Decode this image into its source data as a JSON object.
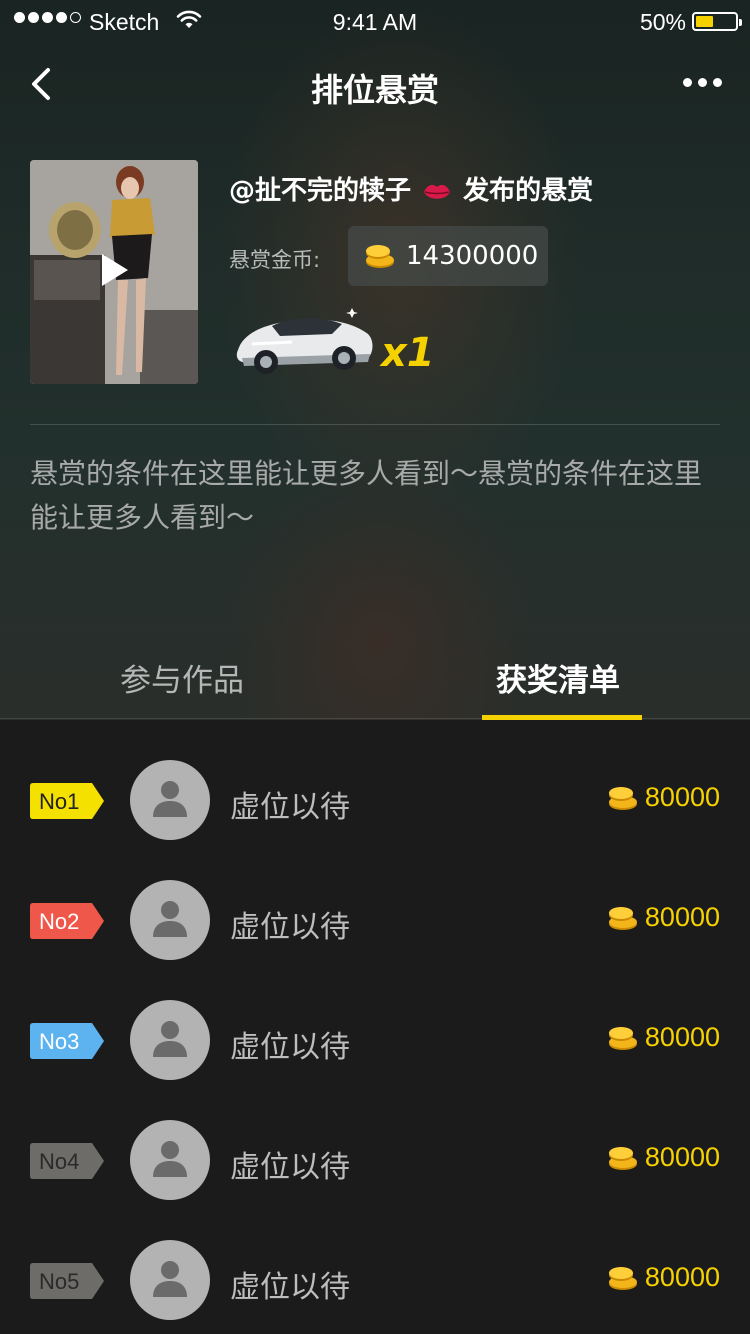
{
  "status_bar": {
    "carrier": "Sketch",
    "time": "9:41 AM",
    "battery": "50%",
    "battery_level": 0.5
  },
  "nav": {
    "title": "排位悬赏",
    "back_icon": "chevron-left-icon",
    "more_icon": "more-dots-icon"
  },
  "reward": {
    "publisher_prefix": "@扯不完的犊子",
    "publisher_suffix": "发布的悬赏",
    "coin_label": "悬赏金币:",
    "coin_amount": "14300000",
    "gift_count": "x1",
    "conditions": "悬赏的条件在这里能让更多人看到～悬赏的条件在这里能让更多人看到～"
  },
  "tabs": [
    {
      "label": "参与作品",
      "active": false
    },
    {
      "label": "获奖清单",
      "active": true
    }
  ],
  "prizes": [
    {
      "rank": "No1",
      "name": "虚位以待",
      "amount": "80000",
      "color": "#f5e100",
      "text_color": "#222222"
    },
    {
      "rank": "No2",
      "name": "虚位以待",
      "amount": "80000",
      "color": "#f0574b",
      "text_color": "#ffffff"
    },
    {
      "rank": "No3",
      "name": "虚位以待",
      "amount": "80000",
      "color": "#5db3f0",
      "text_color": "#ffffff"
    },
    {
      "rank": "No4",
      "name": "虚位以待",
      "amount": "80000",
      "color": "#6e6c69",
      "text_color": "#2a2a2a"
    },
    {
      "rank": "No5",
      "name": "虚位以待",
      "amount": "80000",
      "color": "#6e6c69",
      "text_color": "#2a2a2a"
    }
  ],
  "colors": {
    "accent": "#f5d100",
    "list_bg": "#1b1b1b"
  }
}
